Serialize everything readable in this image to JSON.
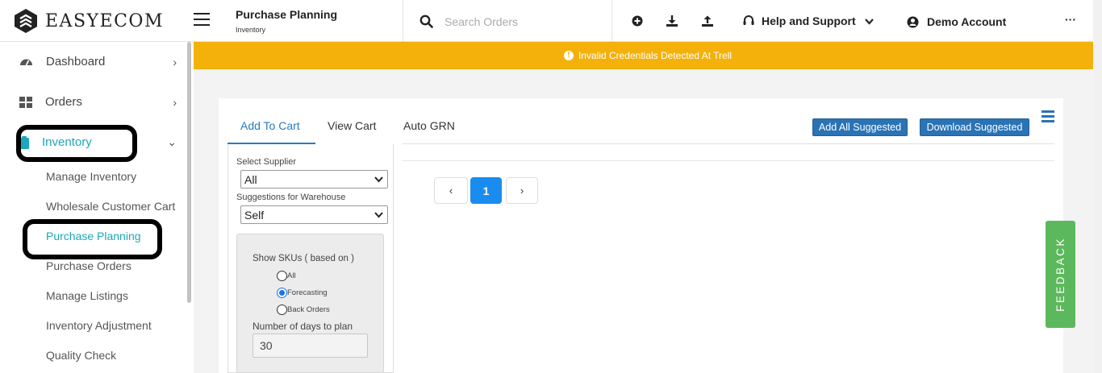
{
  "app": {
    "logo_text": "EASYECOM"
  },
  "header": {
    "title": "Purchase Planning",
    "subtitle": "Inventory",
    "search_placeholder": "Search Orders",
    "help_label": "Help and Support",
    "account_label": "Demo Account",
    "more_label": "···"
  },
  "banner": {
    "text": "Invalid Credentials Detected At Trell",
    "color": "#f4b10b"
  },
  "sidebar": {
    "items": [
      {
        "label": "Dashboard",
        "icon": "dashboard-icon"
      },
      {
        "label": "Orders",
        "icon": "grid-icon"
      },
      {
        "label": "Inventory",
        "icon": "clipboard-icon"
      }
    ],
    "sub_items": [
      {
        "label": "Manage Inventory"
      },
      {
        "label": "Wholesale Customer Cart"
      },
      {
        "label": "Purchase Planning"
      },
      {
        "label": "Purchase Orders"
      },
      {
        "label": "Manage Listings"
      },
      {
        "label": "Inventory Adjustment"
      },
      {
        "label": "Quality Check"
      }
    ],
    "accent_color": "#1ea7b8"
  },
  "tabs": [
    {
      "label": "Add To Cart"
    },
    {
      "label": "View Cart"
    },
    {
      "label": "Auto GRN"
    }
  ],
  "actions": {
    "add_all": "Add All Suggested",
    "download": "Download Suggested"
  },
  "filters": {
    "supplier_label": "Select Supplier",
    "supplier_value": "All",
    "warehouse_label": "Suggestions for Warehouse",
    "warehouse_value": "Self",
    "show_skus_label": "Show SKUs ( based on )",
    "options": [
      {
        "label": "All",
        "checked": false
      },
      {
        "label": "Forecasting",
        "checked": true
      },
      {
        "label": "Back Orders",
        "checked": false
      }
    ],
    "days_label": "Number of days to plan",
    "days_value": "30"
  },
  "pagination": {
    "prev": "‹",
    "current": "1",
    "next": "›"
  },
  "feedback_label": "FEEDBACK"
}
